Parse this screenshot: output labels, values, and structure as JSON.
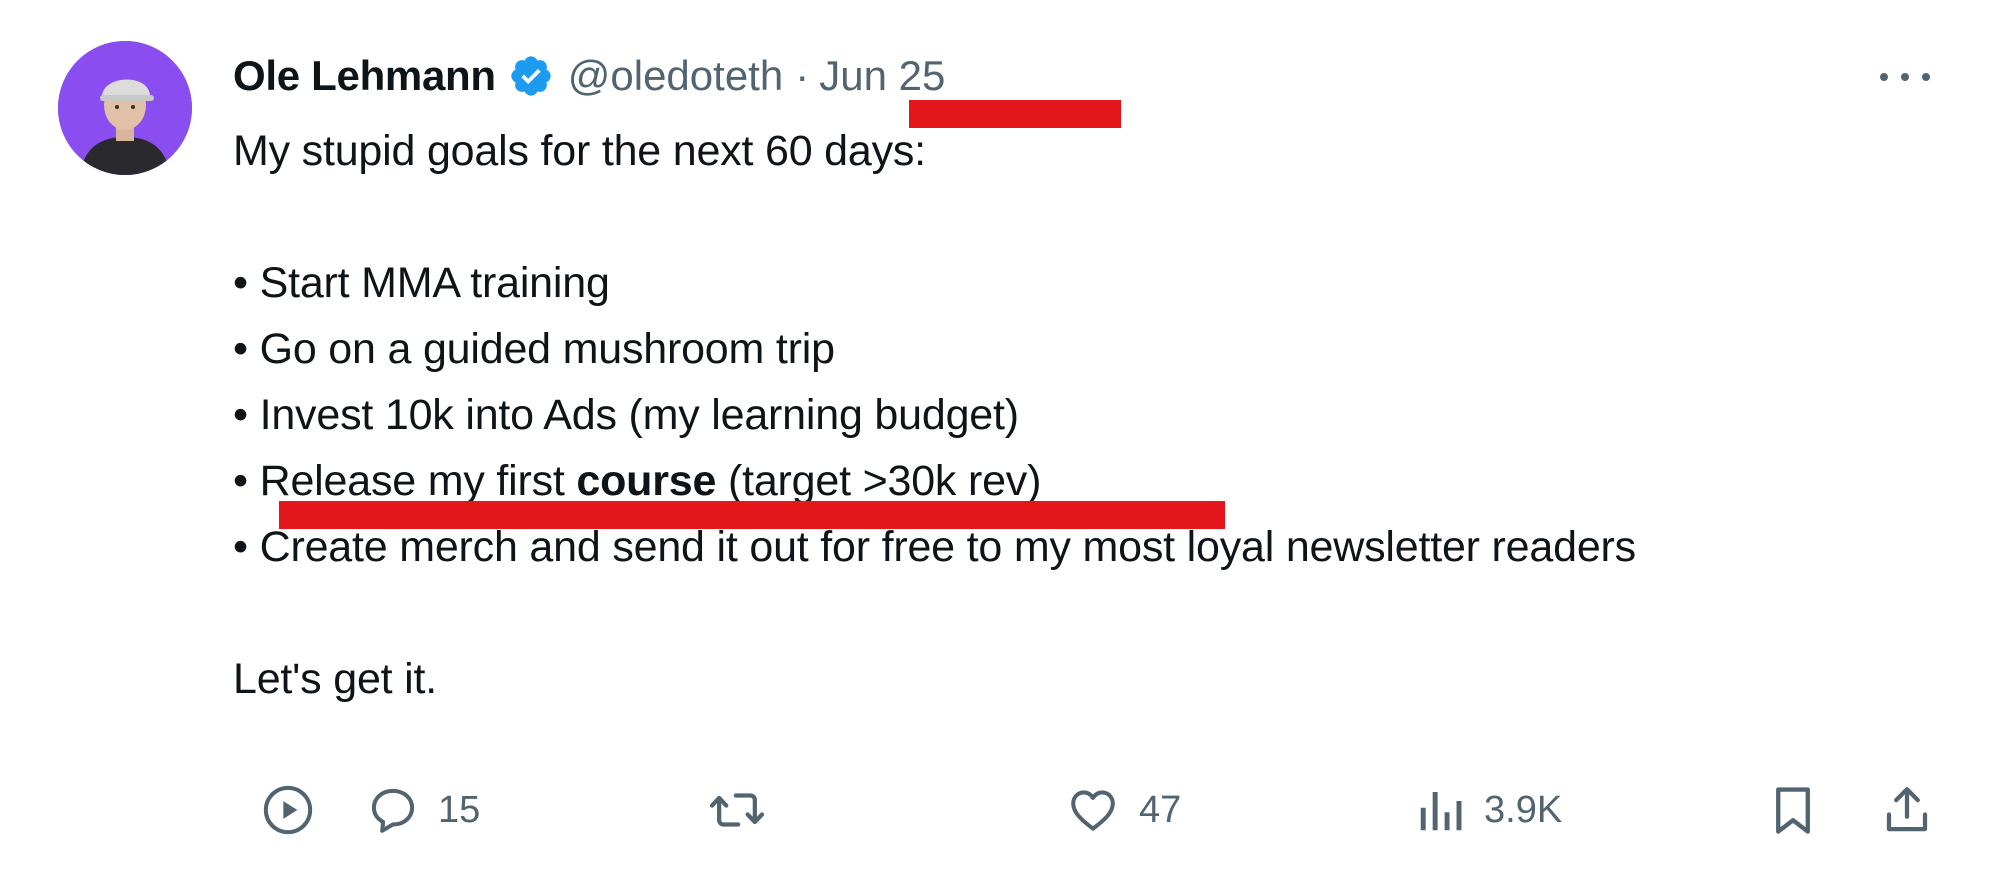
{
  "author": {
    "display_name": "Ole Lehmann",
    "handle": "@oledoteth",
    "separator": "·",
    "date": "Jun 25",
    "verified": true,
    "avatar_color": "#8a4df0"
  },
  "tweet": {
    "line1": "My stupid goals for the next 60 days:",
    "bullets": [
      "• Start MMA training",
      "• Go on a guided mushroom trip",
      "• Invest 10k into Ads (my learning budget)",
      {
        "prefix": "• Release my first ",
        "bold": "course",
        "suffix": " (target >30k rev)"
      },
      "• Create merch and send it out for free to my most loyal newsletter readers"
    ],
    "closing": "Let's get it."
  },
  "actions": {
    "replies": "15",
    "likes": "47",
    "views": "3.9K"
  },
  "colors": {
    "text": "#0f1419",
    "secondary": "#536471",
    "verified_blue": "#1d9bf0",
    "annotation_red": "#e3161c"
  },
  "icons": [
    "play-icon",
    "reply-icon",
    "retweet-icon",
    "like-icon",
    "views-icon",
    "bookmark-icon",
    "share-icon",
    "more-icon",
    "verified-badge-icon"
  ]
}
